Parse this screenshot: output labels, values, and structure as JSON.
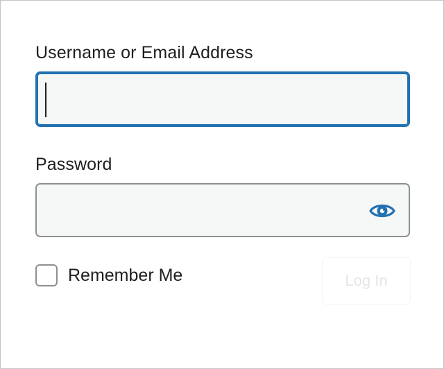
{
  "login_form": {
    "username_label": "Username or Email Address",
    "username_value": "",
    "password_label": "Password",
    "password_value": "",
    "show_password_icon": "eye-icon",
    "remember_label": "Remember Me",
    "remember_checked": false,
    "login_button_label": "Log In"
  },
  "colors": {
    "focus_border": "#2271b1",
    "field_background": "#f6f7f7",
    "field_border": "#8c8f94",
    "icon": "#2271b1",
    "text": "#1e1e1e"
  }
}
